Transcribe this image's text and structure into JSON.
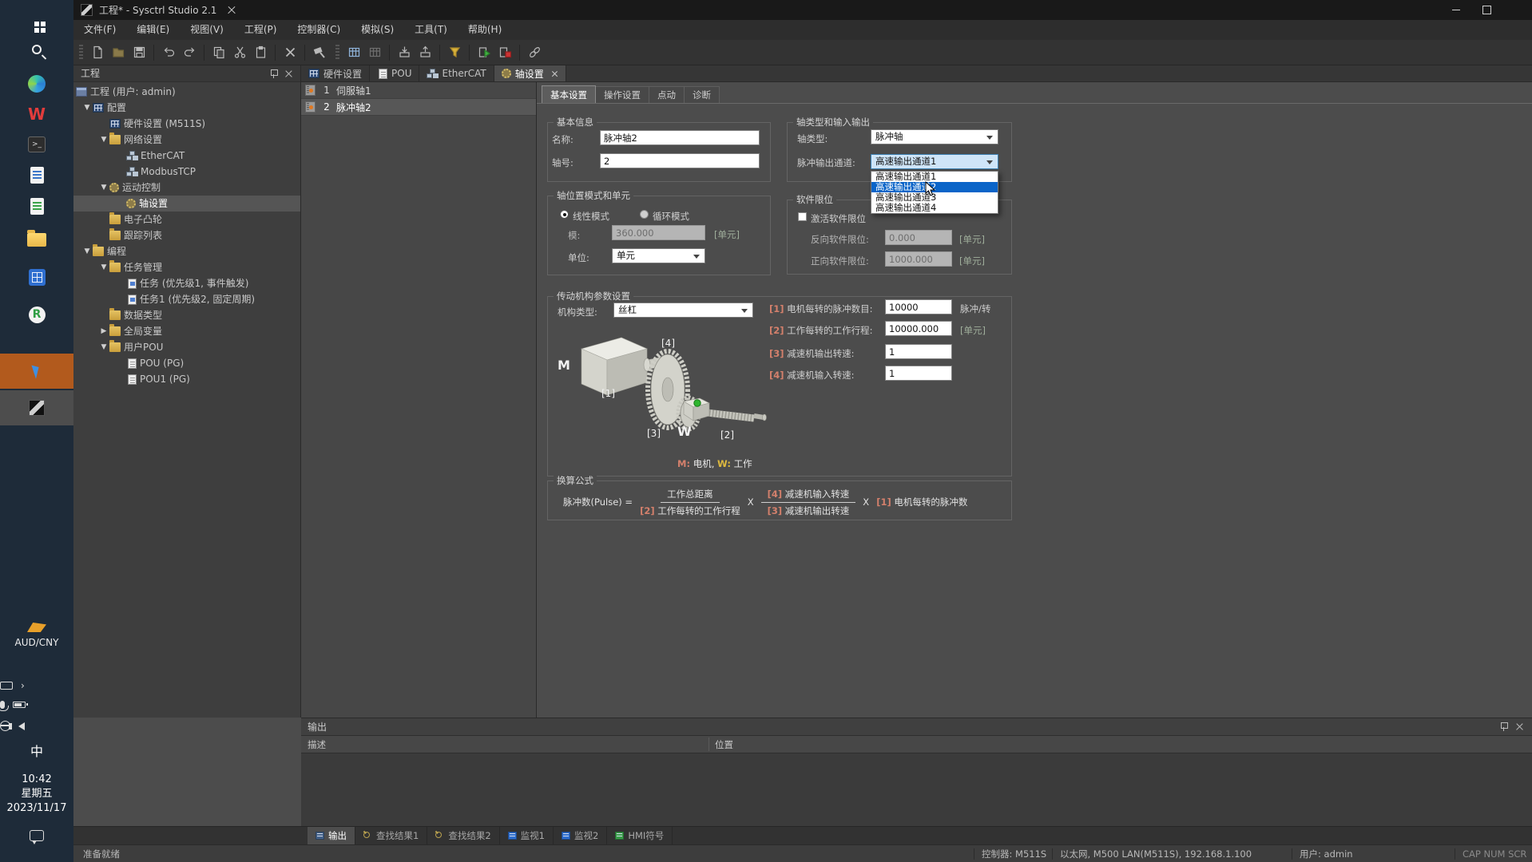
{
  "taskbar": {
    "icons": [
      "windows-start",
      "search",
      "edge-browser",
      "wps-office",
      "terminal",
      "notes-app",
      "green-doc-app",
      "file-explorer",
      "calculator-app",
      "r-app",
      "pointer-app",
      "sysctrl-app"
    ],
    "currency_label": "AUD/CNY",
    "ime": "中",
    "clock": {
      "time": "10:42",
      "weekday": "星期五",
      "date": "2023/11/17"
    }
  },
  "titlebar": {
    "title": "工程* - Sysctrl Studio 2.1"
  },
  "menubar": {
    "items": [
      "文件(F)",
      "编辑(E)",
      "视图(V)",
      "工程(P)",
      "控制器(C)",
      "模拟(S)",
      "工具(T)",
      "帮助(H)"
    ]
  },
  "toolbar": {
    "groups": [
      [
        "new-file",
        "open-folder",
        "save"
      ],
      [
        "undo",
        "redo"
      ],
      [
        "copy",
        "cut",
        "paste"
      ],
      [
        "delete"
      ],
      [
        "build"
      ],
      [
        "hw-table",
        "hw-table2"
      ],
      [
        "download-plc",
        "upload-plc"
      ],
      [
        "filter"
      ],
      [
        "run",
        "stop"
      ],
      [
        "link"
      ]
    ]
  },
  "project_panel": {
    "title": "工程",
    "tree": [
      {
        "label": "工程 (用户: admin)",
        "icon": "project",
        "level": 0,
        "arrow": ""
      },
      {
        "label": "配置",
        "icon": "config",
        "level": 1,
        "arrow": "down"
      },
      {
        "label": "硬件设置 (M511S)",
        "icon": "hardware",
        "level": 2,
        "arrow": ""
      },
      {
        "label": "网络设置",
        "icon": "folder-net",
        "level": 2,
        "arrow": "down"
      },
      {
        "label": "EtherCAT",
        "icon": "net",
        "level": 3,
        "arrow": ""
      },
      {
        "label": "ModbusTCP",
        "icon": "net",
        "level": 3,
        "arrow": ""
      },
      {
        "label": "运动控制",
        "icon": "gear",
        "level": 2,
        "arrow": "down"
      },
      {
        "label": "轴设置",
        "icon": "gear",
        "level": 3,
        "arrow": "",
        "selected": true
      },
      {
        "label": "电子凸轮",
        "icon": "folder",
        "level": 2,
        "arrow": ""
      },
      {
        "label": "跟踪列表",
        "icon": "folder",
        "level": 2,
        "arrow": ""
      },
      {
        "label": "编程",
        "icon": "folder",
        "level": 1,
        "arrow": "down"
      },
      {
        "label": "任务管理",
        "icon": "folder",
        "level": 2,
        "arrow": "down"
      },
      {
        "label": "任务 (优先级1, 事件触发)",
        "icon": "task",
        "level": 3,
        "arrow": ""
      },
      {
        "label": "任务1 (优先级2, 固定周期)",
        "icon": "task",
        "level": 3,
        "arrow": ""
      },
      {
        "label": "数据类型",
        "icon": "folder",
        "level": 2,
        "arrow": ""
      },
      {
        "label": "全局变量",
        "icon": "folder",
        "level": 2,
        "arrow": "right"
      },
      {
        "label": "用户POU",
        "icon": "folder",
        "level": 2,
        "arrow": "down"
      },
      {
        "label": "POU (PG)",
        "icon": "pou",
        "level": 3,
        "arrow": ""
      },
      {
        "label": "POU1 (PG)",
        "icon": "pou",
        "level": 3,
        "arrow": ""
      }
    ]
  },
  "doc_tabs": [
    {
      "label": "硬件设置",
      "icon": "hardware",
      "active": false,
      "closable": false
    },
    {
      "label": "POU",
      "icon": "pou",
      "active": false,
      "closable": false
    },
    {
      "label": "EtherCAT",
      "icon": "net",
      "active": false,
      "closable": false
    },
    {
      "label": "轴设置",
      "icon": "gear",
      "active": true,
      "closable": true
    }
  ],
  "axis_list": [
    {
      "num": "1",
      "label": "伺服轴1",
      "selected": false
    },
    {
      "num": "2",
      "label": "脉冲轴2",
      "selected": true
    }
  ],
  "settings": {
    "tabs": [
      "基本设置",
      "操作设置",
      "点动",
      "诊断"
    ],
    "active_tab": 0,
    "basic_info": {
      "title": "基本信息",
      "name_label": "名称:",
      "name_value": "脉冲轴2",
      "axisno_label": "轴号:",
      "axisno_value": "2"
    },
    "axis_type": {
      "title": "轴类型和输入输出",
      "type_label": "轴类型:",
      "type_value": "脉冲轴",
      "channel_label": "脉冲输出通道:",
      "channel_value": "高速输出通道1",
      "dropdown": [
        "高速输出通道1",
        "高速输出通道2",
        "高速输出通道3",
        "高速输出通道4"
      ],
      "hover_index": 1
    },
    "position_mode": {
      "title": "轴位置模式和单元",
      "radio_linear": "线性模式",
      "radio_cyclic": "循环模式",
      "modulo_label": "模:",
      "modulo_value": "360.000",
      "modulo_unit": "[单元]",
      "unit_label": "单位:",
      "unit_value": "单元"
    },
    "soft_limit": {
      "title": "软件限位",
      "activate_label": "激活软件限位",
      "neg_label": "反向软件限位:",
      "neg_value": "0.000",
      "neg_unit": "[单元]",
      "pos_label": "正向软件限位:",
      "pos_value": "1000.000",
      "pos_unit": "[单元]"
    },
    "transmission": {
      "title": "传动机构参数设置",
      "mech_label": "机构类型:",
      "mech_value": "丝杠",
      "params": [
        {
          "tag": "[1]",
          "label": "电机每转的脉冲数目:",
          "value": "10000",
          "unit": "脉冲/转"
        },
        {
          "tag": "[2]",
          "label": "工作每转的工作行程:",
          "value": "10000.000",
          "unit": "[单元]"
        },
        {
          "tag": "[3]",
          "label": "减速机输出转速:",
          "value": "1",
          "unit": ""
        },
        {
          "tag": "[4]",
          "label": "减速机输入转速:",
          "value": "1",
          "unit": ""
        }
      ],
      "diagram": {
        "m": "M",
        "w": "W",
        "t1": "[1]",
        "t2": "[2]",
        "t3": "[3]",
        "t4": "[4]"
      },
      "legend": {
        "m_tag": "M:",
        "m_text": " 电机, ",
        "w_tag": "W:",
        "w_text": " 工作"
      }
    },
    "formula": {
      "title": "换算公式",
      "lhs": "脉冲数(Pulse) =",
      "f1_num": "工作总距离",
      "f1_den_tag": "[2]",
      "f1_den": " 工作每转的工作行程",
      "times1": "X",
      "f2_num_tag": "[4]",
      "f2_num": " 减速机输入转速",
      "f2_den_tag": "[3]",
      "f2_den": " 减速机输出转速",
      "times2": "X",
      "tail_tag": "[1]",
      "tail": " 电机每转的脉冲数"
    }
  },
  "output_panel": {
    "title": "输出",
    "columns": [
      "描述",
      "位置"
    ]
  },
  "bottom_tabs": [
    {
      "label": "输出",
      "icon": "grid",
      "active": true
    },
    {
      "label": "查找结果1",
      "icon": "mag",
      "active": false
    },
    {
      "label": "查找结果2",
      "icon": "mag",
      "active": false
    },
    {
      "label": "监视1",
      "icon": "watch",
      "active": false
    },
    {
      "label": "监视2",
      "icon": "watch",
      "active": false
    },
    {
      "label": "HMI符号",
      "icon": "hmi",
      "active": false
    }
  ],
  "statusbar": {
    "ready": "准备就绪",
    "controller": "控制器: M511S",
    "network": "以太网, M500 LAN(M511S), 192.168.1.100",
    "user": "用户: admin",
    "locks": "CAP NUM SCR"
  }
}
